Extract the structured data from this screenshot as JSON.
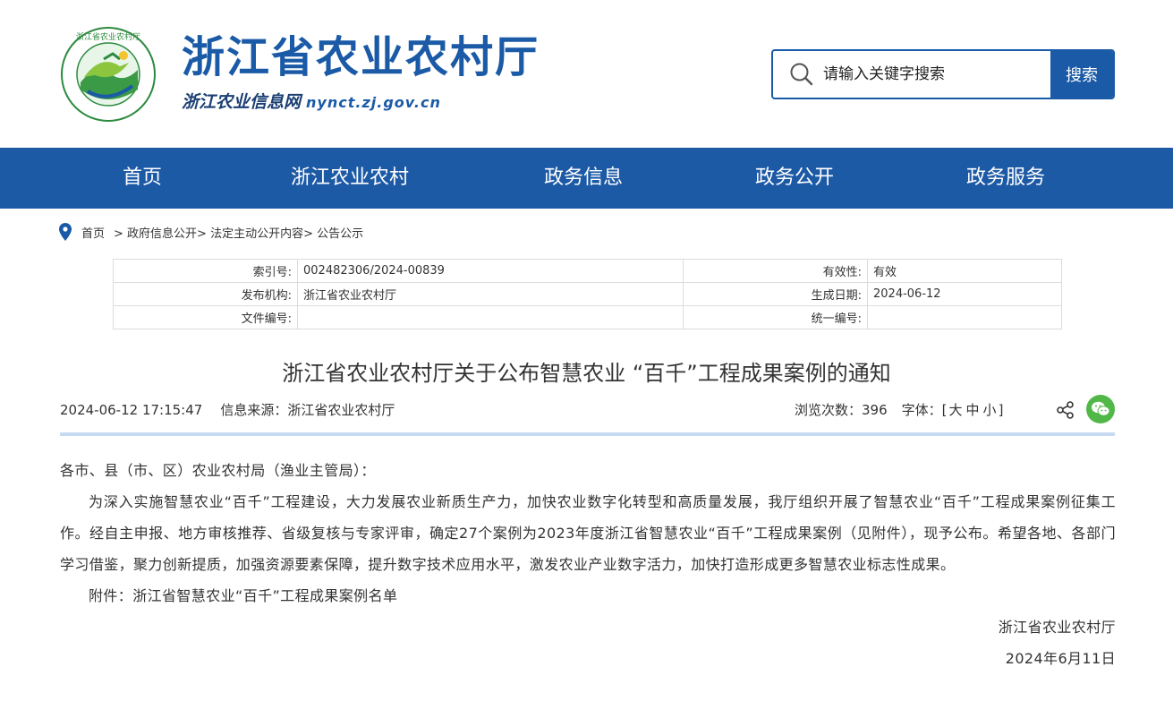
{
  "header": {
    "site_title": "浙江省农业农村厅",
    "site_subtitle": "浙江农业信息网",
    "site_domain": "nynct.zj.gov.cn",
    "logo": {
      "ring_text_top": "浙江省农业农村厅"
    },
    "search": {
      "placeholder": "请输入关键字搜索",
      "button_label": "搜索"
    }
  },
  "nav": {
    "items": [
      {
        "label": "首页"
      },
      {
        "label": "浙江农业农村"
      },
      {
        "label": "政务信息"
      },
      {
        "label": "政务公开"
      },
      {
        "label": "政务服务"
      }
    ]
  },
  "breadcrumb": {
    "home": "首页",
    "path": "> 政府信息公开> 法定主动公开内容> 公告公示"
  },
  "info_table": {
    "index_no_label": "索引号:",
    "index_no_value": "002482306/2024-00839",
    "validity_label": "有效性:",
    "validity_value": "有效",
    "issuer_label": "发布机构:",
    "issuer_value": "浙江省农业农村厅",
    "date_label": "生成日期:",
    "date_value": "2024-06-12",
    "doc_no_label": "文件编号:",
    "doc_no_value": "",
    "unified_no_label": "统一编号:",
    "unified_no_value": ""
  },
  "article": {
    "title": "浙江省农业农村厅关于公布智慧农业 “百千”工程成果案例的通知",
    "datetime": "2024-06-12 17:15:47",
    "source": "信息来源：浙江省农业农村厅",
    "views_label": "浏览次数：",
    "views": "396",
    "font_label": "字体：[",
    "font_large": "大",
    "font_medium": "中",
    "font_small": "小",
    "font_close": "]",
    "salutation": "各市、县（市、区）农业农村局（渔业主管局）：",
    "paragraph": "为深入实施智慧农业“百千”工程建设，大力发展农业新质生产力，加快农业数字化转型和高质量发展，我厅组织开展了智慧农业“百千”工程成果案例征集工作。经自主申报、地方审核推荐、省级复核与专家评审，确定27个案例为2023年度浙江省智慧农业“百千”工程成果案例（见附件），现予公布。希望各地、各部门学习借鉴，聚力创新提质，加强资源要素保障，提升数字技术应用水平，激发农业产业数字活力，加快打造形成更多智慧农业标志性成果。",
    "attachment": "附件：浙江省智慧农业“百千”工程成果案例名单",
    "signature": "浙江省农业农村厅",
    "sign_date": "2024年6月11日"
  },
  "colors": {
    "brand_blue": "#1d5aa6",
    "wechat_green": "#51b848",
    "divider": "#c6daf1"
  }
}
